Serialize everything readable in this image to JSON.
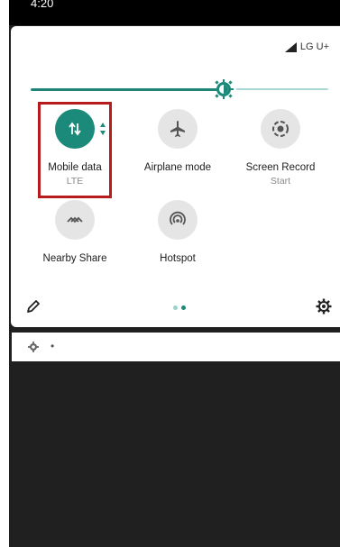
{
  "status_bar": {
    "time": "4:20"
  },
  "carrier": {
    "label": "LG U+"
  },
  "brightness": {
    "level": 0.68
  },
  "tiles": [
    {
      "label": "Mobile data",
      "sub": "LTE",
      "active": true,
      "icon": "mobile-data-icon"
    },
    {
      "label": "Airplane mode",
      "sub": "",
      "active": false,
      "icon": "airplane-icon"
    },
    {
      "label": "Screen Record",
      "sub": "Start",
      "active": false,
      "icon": "screen-record-icon"
    },
    {
      "label": "Nearby Share",
      "sub": "",
      "active": false,
      "icon": "nearby-share-icon"
    },
    {
      "label": "Hotspot",
      "sub": "",
      "active": false,
      "icon": "hotspot-icon"
    }
  ],
  "pages": {
    "count": 2,
    "current": 2
  },
  "colors": {
    "accent": "#1b8a7a",
    "accent_light": "#a7d8d1",
    "highlight": "#b71c1c"
  },
  "notification": {
    "bullet": "•"
  }
}
